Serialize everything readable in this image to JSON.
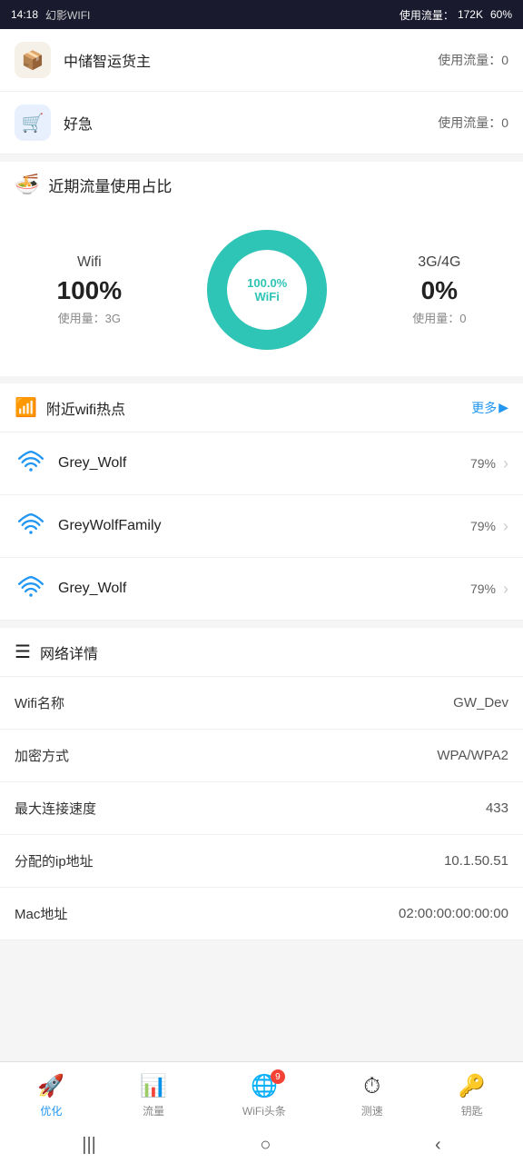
{
  "statusBar": {
    "time": "14:18",
    "appName": "幻影WIFI",
    "usageLabel": "使用流量：",
    "usageValue": "172K",
    "battery": "60%"
  },
  "appList": [
    {
      "icon": "📦",
      "iconBg": "orange",
      "name": "中储智运货主",
      "trafficLabel": "使用流量：",
      "trafficValue": "0"
    },
    {
      "icon": "🛒",
      "iconBg": "blue",
      "name": "好急",
      "trafficLabel": "使用流量：",
      "trafficValue": "0"
    }
  ],
  "trafficSection": {
    "headerIcon": "🍜",
    "headerTitle": "近期流量使用占比",
    "wifi": {
      "label": "Wifi",
      "percent": "100%",
      "usageLabel": "使用量：3G"
    },
    "cellular": {
      "label": "3G/4G",
      "percent": "0%",
      "usageLabel": "使用量：0"
    },
    "donut": {
      "wifiPercent": 100,
      "cellularPercent": 0,
      "centerLine1": "100.0%",
      "centerLine2": "WiFi",
      "wifiColor": "#2ec4b6",
      "cellularColor": "#e0e0e0"
    }
  },
  "wifiHotspot": {
    "headerIcon": "📶",
    "headerTitle": "附近wifi热点",
    "moreLabel": "更多",
    "items": [
      {
        "name": "Grey_Wolf",
        "strength": "79%"
      },
      {
        "name": "GreyWolfFamily",
        "strength": "79%"
      },
      {
        "name": "Grey_Wolf",
        "strength": "79%"
      }
    ]
  },
  "networkDetail": {
    "headerIcon": "☰",
    "headerTitle": "网络详情",
    "rows": [
      {
        "key": "Wifi名称",
        "value": "GW_Dev"
      },
      {
        "key": "加密方式",
        "value": "WPA/WPA2"
      },
      {
        "key": "最大连接速度",
        "value": "433"
      },
      {
        "key": "分配的ip地址",
        "value": "10.1.50.51"
      },
      {
        "key": "Mac地址",
        "value": "02:00:00:00:00:00"
      }
    ]
  },
  "bottomNav": {
    "items": [
      {
        "id": "optimize",
        "icon": "🚀",
        "label": "优化",
        "active": true,
        "badge": null
      },
      {
        "id": "traffic",
        "icon": "📊",
        "label": "流量",
        "active": false,
        "badge": null
      },
      {
        "id": "wifi-news",
        "icon": "🌐",
        "label": "WiFi头条",
        "active": false,
        "badge": "9"
      },
      {
        "id": "speed-test",
        "icon": "⏱",
        "label": "测速",
        "active": false,
        "badge": null
      },
      {
        "id": "key",
        "icon": "🔑",
        "label": "钥匙",
        "active": false,
        "badge": null
      }
    ]
  }
}
